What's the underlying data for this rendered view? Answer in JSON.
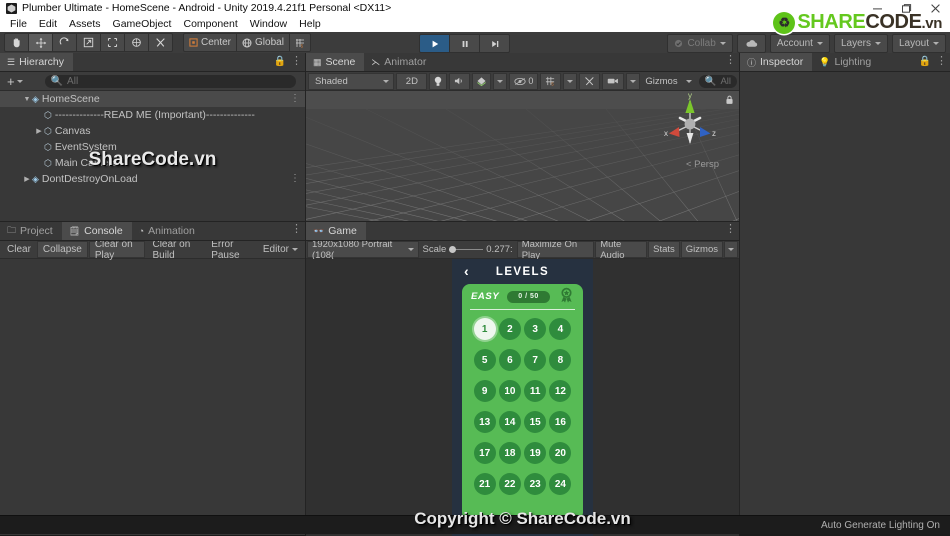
{
  "window": {
    "title": "Plumber Ultimate - HomeScene - Android - Unity 2019.4.21f1 Personal <DX11>",
    "app_icon": "unity-icon",
    "minimize": "minimize-icon",
    "maximize": "maximize-icon",
    "close": "close-icon"
  },
  "menu": {
    "items": [
      "File",
      "Edit",
      "Assets",
      "GameObject",
      "Component",
      "Window",
      "Help"
    ]
  },
  "watermark": {
    "logo_share": "SHARE",
    "logo_code": "CODE",
    "logo_vn": ".vn",
    "hierarchy_text": "ShareCode.vn",
    "game_text": "Copyright © ShareCode.vn"
  },
  "toolbar": {
    "tools": [
      {
        "name": "hand-tool",
        "glyph": "✋",
        "selected": false
      },
      {
        "name": "move-tool",
        "glyph": "✥",
        "selected": true
      },
      {
        "name": "rotate-tool",
        "glyph": "⟳",
        "selected": false
      },
      {
        "name": "scale-tool",
        "glyph": "⤢",
        "selected": false
      },
      {
        "name": "rect-tool",
        "glyph": "⬚",
        "selected": false
      },
      {
        "name": "transform-tool",
        "glyph": "✸",
        "selected": false
      },
      {
        "name": "custom-tool",
        "glyph": "⚒",
        "selected": false
      }
    ],
    "pivot_label": "Center",
    "handle_label": "Global",
    "snap_label": "",
    "play": "play-icon",
    "pause": "pause-icon",
    "step": "step-icon",
    "collab": "Collab",
    "cloud": "cloud-icon",
    "account": "Account",
    "layers": "Layers",
    "layout": "Layout"
  },
  "hierarchy": {
    "tab": "Hierarchy",
    "add_label": "+",
    "search_placeholder": "All",
    "rows": [
      {
        "label": "HomeScene",
        "indent": 0,
        "icon": "scene-icon",
        "triangle": "down",
        "selected": true,
        "kebab": true
      },
      {
        "label": "--------------READ ME (Important)--------------",
        "indent": 2,
        "icon": "gameobject-icon",
        "triangle": "",
        "selected": false,
        "kebab": false
      },
      {
        "label": "Canvas",
        "indent": 1,
        "icon": "gameobject-icon",
        "triangle": "right",
        "selected": false,
        "kebab": false
      },
      {
        "label": "EventSystem",
        "indent": 2,
        "icon": "gameobject-icon",
        "triangle": "",
        "selected": false,
        "kebab": false
      },
      {
        "label": "Main Camera",
        "indent": 2,
        "icon": "gameobject-icon",
        "triangle": "",
        "selected": false,
        "kebab": false
      },
      {
        "label": "DontDestroyOnLoad",
        "indent": 0,
        "icon": "scene-icon",
        "triangle": "right",
        "selected": false,
        "kebab": true
      }
    ]
  },
  "scene": {
    "tabs": [
      {
        "label": "Scene",
        "icon": "scene-tab-icon",
        "selected": true
      },
      {
        "label": "Animator",
        "icon": "animator-tab-icon",
        "selected": false
      }
    ],
    "shading": "Shaded",
    "dimension": "2D",
    "lighting_icon": "lightbulb-icon",
    "audio_icon": "audio-icon",
    "fx_icon": "fx-icon",
    "visibility_label": "0",
    "grid_icon": "grid-icon",
    "tool_icon": "scene-tools-icon",
    "camera_icon": "camera-icon",
    "gizmos": "Gizmos",
    "search_placeholder": "All",
    "projection": "< Persp",
    "axis_x": "x",
    "axis_y": "y",
    "axis_z": "z"
  },
  "inspector": {
    "tabs": [
      {
        "label": "Inspector",
        "icon": "inspector-icon",
        "selected": true
      },
      {
        "label": "Lighting",
        "icon": "lighting-icon",
        "selected": false
      }
    ]
  },
  "project_panel": {
    "tabs": [
      {
        "label": "Project",
        "icon": "folder-icon",
        "selected": false
      },
      {
        "label": "Console",
        "icon": "console-icon",
        "selected": true
      },
      {
        "label": "Animation",
        "icon": "animation-icon",
        "selected": false
      }
    ],
    "console_buttons": [
      "Clear",
      "Collapse",
      "Clear on Play",
      "Clear on Build",
      "Error Pause",
      "Editor"
    ]
  },
  "game": {
    "tab": "Game",
    "resolution": "1920x1080 Portrait (108(",
    "scale_label": "Scale",
    "scale_value": "0.277:",
    "maximize": "Maximize On Play",
    "mute": "Mute Audio",
    "stats": "Stats",
    "gizmos": "Gizmos",
    "screen": {
      "back_icon": "back-chevron-icon",
      "title": "LEVELS",
      "difficulty": "EASY",
      "progress": "0 / 50",
      "medal_icon": "medal-icon",
      "levels": [
        {
          "n": "1",
          "current": true
        },
        {
          "n": "2",
          "current": false
        },
        {
          "n": "3",
          "current": false
        },
        {
          "n": "4",
          "current": false
        },
        {
          "n": "5",
          "current": false
        },
        {
          "n": "6",
          "current": false
        },
        {
          "n": "7",
          "current": false
        },
        {
          "n": "8",
          "current": false
        },
        {
          "n": "9",
          "current": false
        },
        {
          "n": "10",
          "current": false
        },
        {
          "n": "11",
          "current": false
        },
        {
          "n": "12",
          "current": false
        },
        {
          "n": "13",
          "current": false
        },
        {
          "n": "14",
          "current": false
        },
        {
          "n": "15",
          "current": false
        },
        {
          "n": "16",
          "current": false
        },
        {
          "n": "17",
          "current": false
        },
        {
          "n": "18",
          "current": false
        },
        {
          "n": "19",
          "current": false
        },
        {
          "n": "20",
          "current": false
        },
        {
          "n": "21",
          "current": false
        },
        {
          "n": "22",
          "current": false
        },
        {
          "n": "23",
          "current": false
        },
        {
          "n": "24",
          "current": false
        }
      ]
    }
  },
  "statusbar": {
    "message": "Auto Generate Lighting On"
  },
  "colors": {
    "accent_play": "#2b5c87",
    "panel_bg": "#383838",
    "toolbar_bg": "#3c3c3c",
    "green_card": "#57bb55",
    "green_cell": "#2f8c3d",
    "logo_green": "#64c81e"
  }
}
